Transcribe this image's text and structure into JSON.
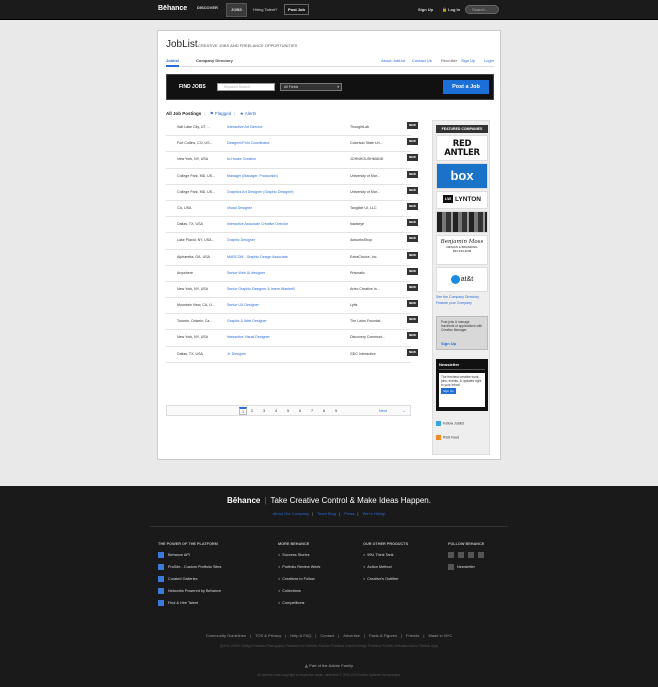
{
  "topbar": {
    "logo": "Bēhance",
    "nav": [
      "DISCOVER",
      "JOBS"
    ],
    "hiring": "Hiring Talent?",
    "post_job": "Post Job",
    "sign_up": "Sign Up",
    "log_in": "Log In",
    "search_placeholder": "Search..."
  },
  "page": {
    "title": "JobList",
    "subtitle": "CREATIVE JOBS AND FREELANCE OPPORTUNITIES",
    "tabs": [
      "Joblist",
      "Company Directory"
    ],
    "right_links": [
      "About JobList",
      "Contact Us",
      "Recruiter",
      "Sign Up",
      "Login"
    ]
  },
  "find": {
    "label": "FIND JOBS",
    "keyword_placeholder": "Keyword Search",
    "field_value": "All Fields",
    "post_button": "Post a Job"
  },
  "filters": {
    "all": "All Job Postings",
    "flagged": "Flagged",
    "alerts": "Alerts"
  },
  "jobs": [
    {
      "loc": "Salt Lake City, UT, ...",
      "title": "Interactive Art Director",
      "company": "ThoughtLab",
      "badge": "NEW"
    },
    {
      "loc": "Fort Collins, CO, US...",
      "title": "Designer/Print Coordinator",
      "company": "Colorado State Un...",
      "badge": "NEW"
    },
    {
      "loc": "New York, NY, USA",
      "title": "In-House Creative",
      "company": "JOHNHOUSHMAND",
      "badge": "NEW"
    },
    {
      "loc": "College Park, MD, US...",
      "title": "Manager (Manager, Production)",
      "company": "University of Mar...",
      "badge": "NEW"
    },
    {
      "loc": "College Park, MD, US...",
      "title": "Graphics Art Designer (Graphic Designer)",
      "company": "University of Mar...",
      "badge": "NEW"
    },
    {
      "loc": "CA, USA",
      "title": "Visual Designer",
      "company": "Tangible UI, LLC",
      "badge": "NEW"
    },
    {
      "loc": "Dallas, TX, USA",
      "title": "Interactive Associate Creative Director",
      "company": "hawkeye",
      "badge": "NEW"
    },
    {
      "loc": "Lake Placid, NY, USA...",
      "title": "Graphic Designer",
      "company": "AdworksShop",
      "badge": "NEW"
    },
    {
      "loc": "Alpharetta, GA, USA",
      "title": "MARCOM - Graphic Design Associate",
      "company": "ExtraChoice, Inc.",
      "badge": "NEW"
    },
    {
      "loc": "Anywhere",
      "title": "Senior Web UI designer",
      "company": "Prismatic",
      "badge": "NEW"
    },
    {
      "loc": "New York, NY, USA",
      "title": "Senior Graphic Designer & Intern Wanted!!",
      "company": "Artec Creative In...",
      "badge": "NEW"
    },
    {
      "loc": "Mountain View, CA, U...",
      "title": "Senior UX Designer",
      "company": "Lyfts",
      "badge": "NEW"
    },
    {
      "loc": "Toronto, Ontario, Ca...",
      "title": "Graphic & Web Designer",
      "company": "The Lotus Foundat...",
      "badge": "NEW"
    },
    {
      "loc": "New York, NY, USA",
      "title": "Interactive Visual Designer",
      "company": "Discovery Communi...",
      "badge": "NEW"
    },
    {
      "loc": "Dallas, TX, USA",
      "title": "Jr. Designer",
      "company": "GDC Interactive",
      "badge": "NEW"
    }
  ],
  "pager": {
    "pages": [
      "1",
      "2",
      "3",
      "4",
      "5",
      "6",
      "7",
      "8",
      "9"
    ],
    "current": "1",
    "next": "Next",
    "arrow": "→"
  },
  "sidebar": {
    "heading": "FEATURED COMPANIES",
    "red_antler": "RED ANTLER",
    "box": "box",
    "lynton_mark": "LW",
    "lynton": "LYNTON",
    "benjamin": "Benjamin Moss",
    "benjamin_small": "DESIGN & BRANDING",
    "benjamin_phone": "833.334.4299",
    "att": "at&t",
    "see_directory": "See the Company Directory",
    "feature_company": "Feature your Company",
    "promo_text": "Post jobs & manage hundreds of applications with Creative Manager.",
    "promo_signup": "Sign Up",
    "newsletter_title": "Newsletter",
    "newsletter_text": "The freshest creative work, jobs, events, & updates right to your inbox!",
    "newsletter_btn": "Sign Up",
    "follow": "Follow Joblist",
    "rss": "RSS Feed"
  },
  "footer": {
    "brand": "Bēhance",
    "tagline": "Take Creative Control & Make Ideas Happen.",
    "links": [
      "About Our Company",
      "Team Blog",
      "Press",
      "We're Hiring!"
    ],
    "col1": {
      "heading": "THE POWER OF THE PLATFORM",
      "items": [
        "Behance API",
        "ProSite - Custom Portfolio Sites",
        "Curated Galleries",
        "Networks Powered by Behance",
        "Find & Hire Talent"
      ]
    },
    "col2": {
      "heading": "MORE BEHANCE",
      "items": [
        "Success Stories",
        "Portfolio Review Week",
        "Creatives to Follow",
        "Collections",
        "Competitions"
      ]
    },
    "col3": {
      "heading": "OUR OTHER PRODUCTS",
      "items": [
        "99U Think Tank",
        "Action Method",
        "Creative's Outfitter"
      ]
    },
    "col4": {
      "heading": "FOLLOW BEHANCE",
      "items": [
        "Newsletter"
      ]
    },
    "bottom_links": [
      "Community Guidelines",
      "TOS & Privacy",
      "Help & FAQ",
      "Contact",
      "Advertise",
      "Facts & Figures",
      "Friends",
      "Made in NYC"
    ],
    "portfolio_links": "QUICK LINKS: Design Portfolios   Photography Portfolios   Art Portfolios   Fashion Portfolios   Graphic Design Portfolios   Portfolio Websites   Adobe Portfolio Apps",
    "adobe": "Part of the Adobe Family",
    "copyright": "All member work copyright of respective owner, otherwise © 2005-2013 Adobe Systems Incorporated."
  }
}
